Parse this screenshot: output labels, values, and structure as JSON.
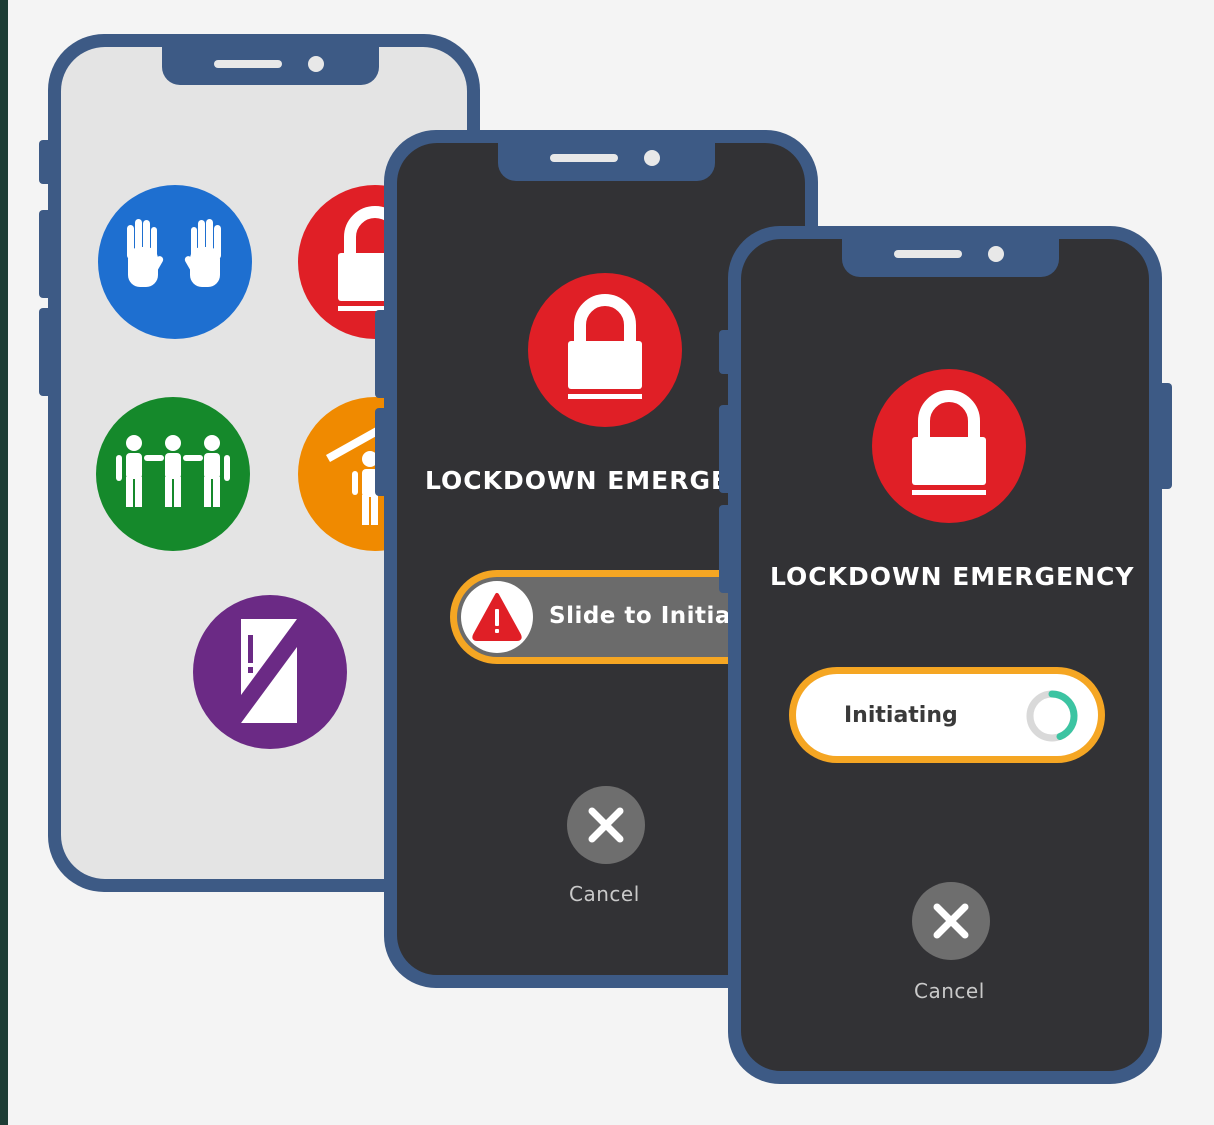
{
  "phones": {
    "menu": {
      "icons": [
        "hands-up-icon",
        "lock-icon",
        "group-icon",
        "shelter-icon",
        "door-icon"
      ],
      "colors": {
        "blue": "#1e6fd0",
        "red": "#e01f26",
        "green": "#15892b",
        "orange": "#f08a00",
        "purple": "#6b2a85"
      }
    },
    "slide": {
      "title": "LOCKDOWN EMERGENCY",
      "slider_label": "Slide to Initiate",
      "cancel_label": "Cancel"
    },
    "initiating": {
      "title": "LOCKDOWN EMERGENCY",
      "status_label": "Initiating",
      "cancel_label": "Cancel"
    }
  },
  "colors": {
    "frame": "#3d5a85",
    "dark_screen": "#323235",
    "light_screen": "#e4e4e4",
    "accent_orange": "#f5a623",
    "alert_red": "#e01f26"
  }
}
